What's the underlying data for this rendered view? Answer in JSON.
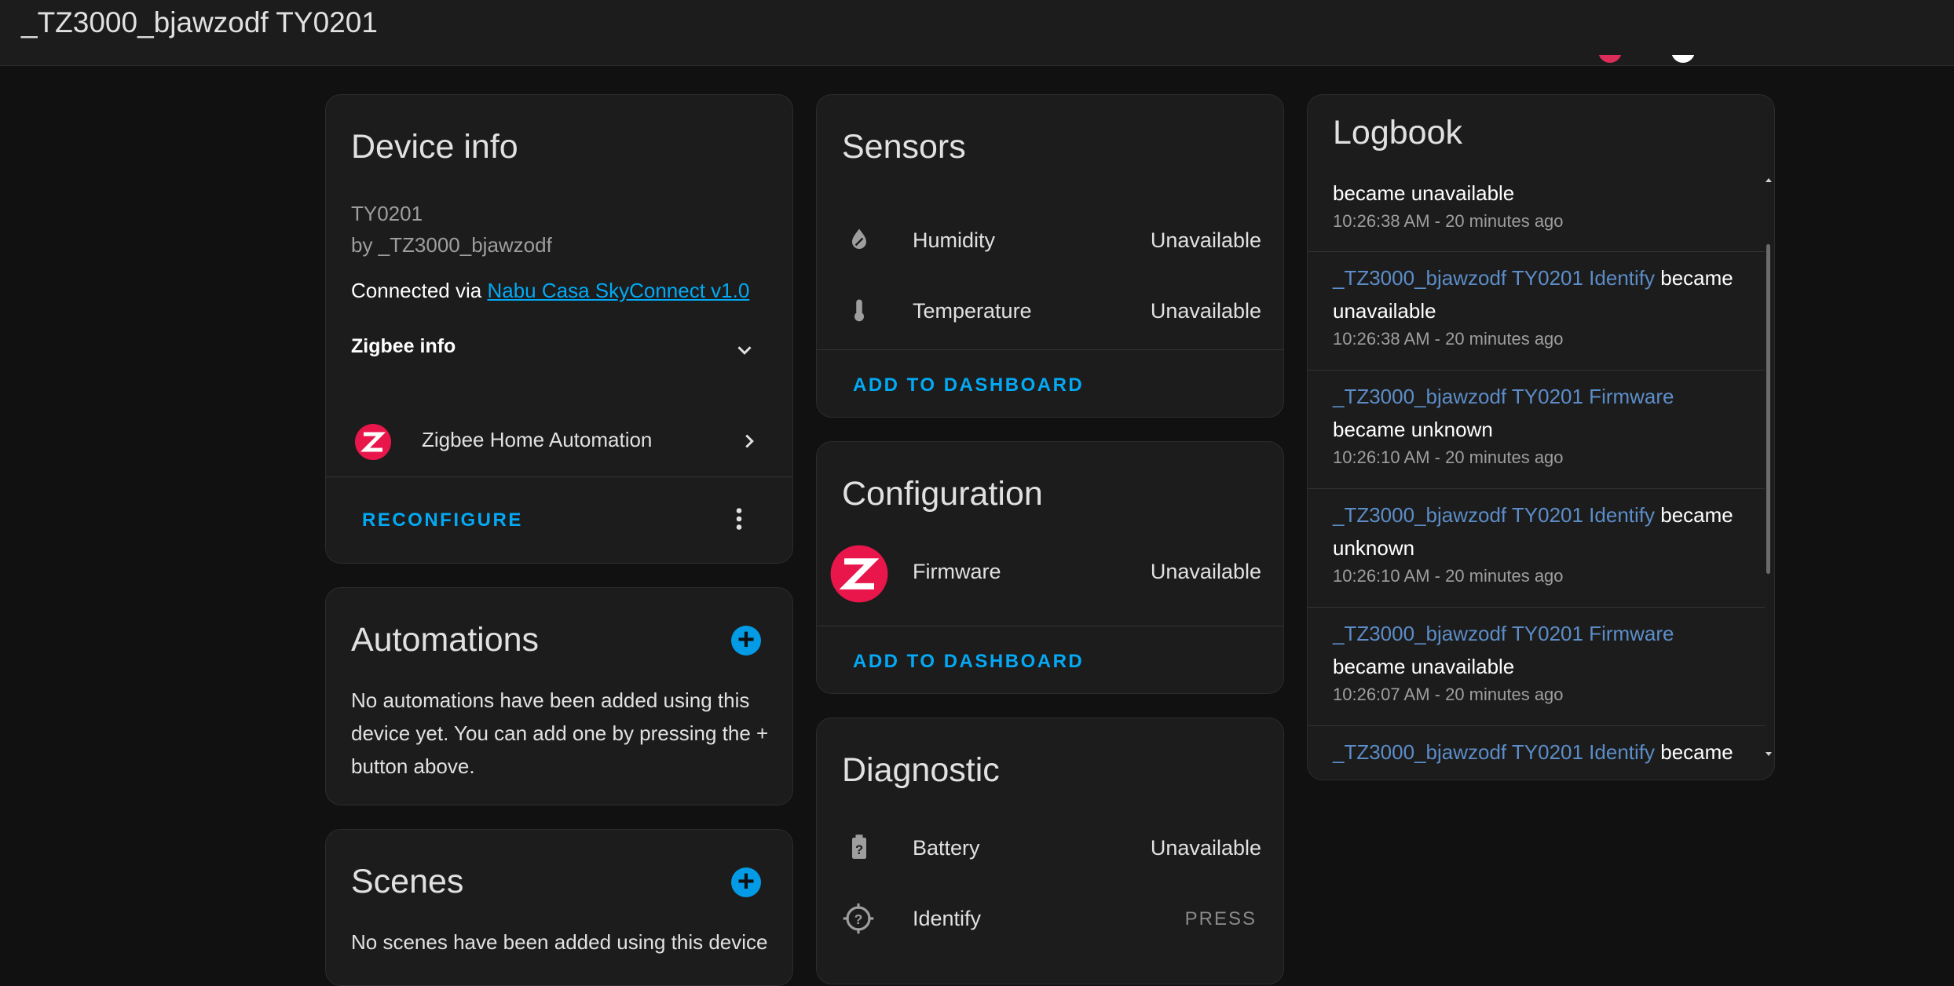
{
  "header": {
    "title": "_TZ3000_bjawzodf TY0201"
  },
  "device_info": {
    "title": "Device info",
    "model": "TY0201",
    "manufacturer": "by _TZ3000_bjawzodf",
    "connected_prefix": "Connected via",
    "connected_link": "Nabu Casa SkyConnect v1.0",
    "zigbee_info_label": "Zigbee info",
    "integration_label": "Zigbee Home Automation",
    "reconfigure_label": "RECONFIGURE"
  },
  "automations": {
    "title": "Automations",
    "text": "No automations have been added using this device yet. You can add one by pressing the + button above."
  },
  "scenes": {
    "title": "Scenes",
    "text": "No scenes have been added using this device"
  },
  "sensors": {
    "title": "Sensors",
    "rows": [
      {
        "name": "Humidity",
        "value": "Unavailable",
        "icon": "humidity-off-icon"
      },
      {
        "name": "Temperature",
        "value": "Unavailable",
        "icon": "thermometer-icon"
      }
    ],
    "add_label": "ADD TO DASHBOARD"
  },
  "configuration": {
    "title": "Configuration",
    "rows": [
      {
        "name": "Firmware",
        "value": "Unavailable",
        "icon": "zigbee-logo-icon"
      }
    ],
    "add_label": "ADD TO DASHBOARD"
  },
  "diagnostic": {
    "title": "Diagnostic",
    "rows": [
      {
        "name": "Battery",
        "value": "Unavailable",
        "icon": "battery-unknown-icon"
      },
      {
        "name": "Identify",
        "value": "PRESS",
        "icon": "crosshairs-question-icon"
      }
    ]
  },
  "logbook": {
    "title": "Logbook",
    "entries": [
      {
        "entity": "",
        "message": "became unavailable",
        "time": "10:26:38 AM - 20 minutes ago"
      },
      {
        "entity": "_TZ3000_bjawzodf TY0201 Identify",
        "message": "became unavailable",
        "time": "10:26:38 AM - 20 minutes ago"
      },
      {
        "entity": "_TZ3000_bjawzodf TY0201 Firmware",
        "message": "became unknown",
        "time": "10:26:10 AM - 20 minutes ago"
      },
      {
        "entity": "_TZ3000_bjawzodf TY0201 Identify",
        "message": "became unknown",
        "time": "10:26:10 AM - 20 minutes ago"
      },
      {
        "entity": "_TZ3000_bjawzodf TY0201 Firmware",
        "message": "became unavailable",
        "time": "10:26:07 AM - 20 minutes ago"
      },
      {
        "entity": "_TZ3000_bjawzodf TY0201 Identify",
        "message": "became",
        "time": ""
      }
    ]
  },
  "colors": {
    "accent": "#03a9f4",
    "zigbee_red": "#e8164b",
    "background": "#111111",
    "card": "#1c1c1c"
  }
}
